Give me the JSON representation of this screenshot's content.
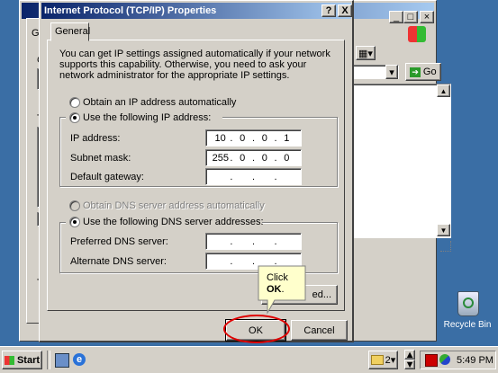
{
  "background_window": {
    "title_fragment": "L",
    "tab_fragment": "Ge",
    "go_label": "Go",
    "button_fragment": "ed...",
    "side_letters": [
      "C",
      "T",
      "T"
    ]
  },
  "dialog": {
    "title": "Internet Protocol (TCP/IP) Properties",
    "help_btn": "?",
    "close_btn": "X",
    "tab_general": "General",
    "intro": "You can get IP settings assigned automatically if your network supports this capability. Otherwise, you need to ask your network administrator for the appropriate IP settings.",
    "radio_auto_ip": "Obtain an IP address automatically",
    "radio_manual_ip": "Use the following IP address:",
    "ip_label": "IP address:",
    "ip_value": [
      "10",
      "0",
      "0",
      "1"
    ],
    "subnet_label": "Subnet mask:",
    "subnet_value": [
      "255",
      "0",
      "0",
      "0"
    ],
    "gateway_label": "Default gateway:",
    "radio_auto_dns": "Obtain DNS server address automatically",
    "radio_manual_dns": "Use the following DNS server addresses:",
    "pref_dns_label": "Preferred DNS server:",
    "alt_dns_label": "Alternate DNS server:",
    "advanced_label": "ed...",
    "ok_label": "OK",
    "cancel_label": "Cancel"
  },
  "callout": {
    "line1": "Click",
    "line2": "OK",
    "line2_suffix": "."
  },
  "desktop": {
    "recycle_bin_label": "Recycle Bin"
  },
  "taskbar": {
    "start_label": "Start",
    "task_count": "2",
    "clock": "5:49 PM"
  },
  "colors": {
    "desktop": "#3a6ea5",
    "callout_fill": "#ffffcc",
    "highlight_ring": "#e00000"
  }
}
